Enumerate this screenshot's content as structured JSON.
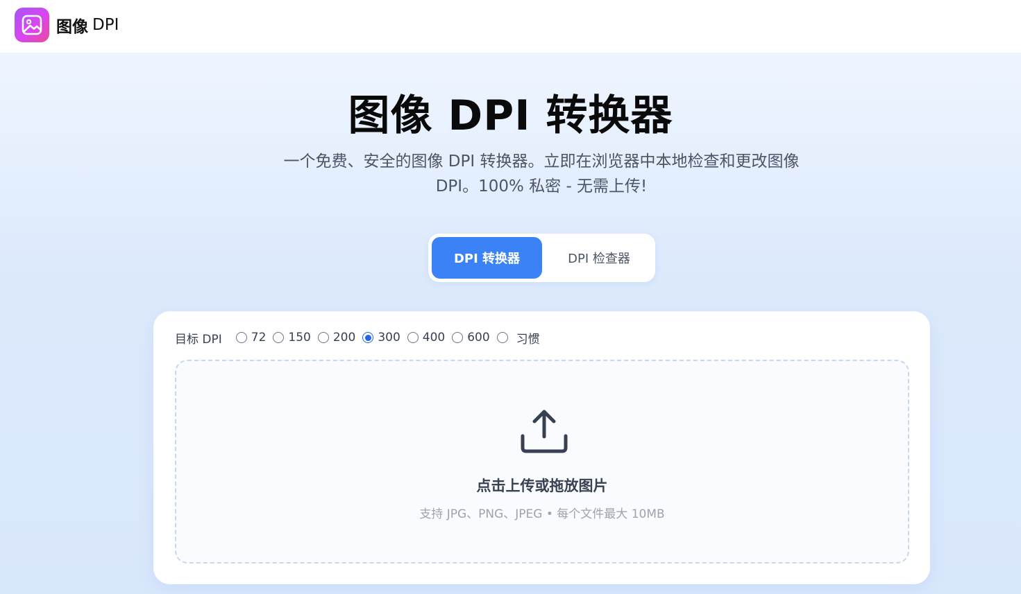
{
  "header": {
    "logo_icon": "image-icon",
    "brand_cn": "图像",
    "brand_en": "DPI"
  },
  "hero": {
    "title": "图像 DPI 转换器",
    "subtitle_line1": "一个免费、安全的图像 DPI 转换器。立即在浏览器中本地检查和更改图像",
    "subtitle_line2": "DPI。100% 私密 - 无需上传!"
  },
  "tabs": [
    {
      "label": "DPI 转换器",
      "active": true
    },
    {
      "label": "DPI 检查器",
      "active": false
    }
  ],
  "dpi_selector": {
    "label": "目标 DPI",
    "options": [
      "72",
      "150",
      "200",
      "300",
      "400",
      "600",
      "习惯"
    ],
    "selected": "300"
  },
  "dropzone": {
    "icon": "upload-icon",
    "title": "点击上传或拖放图片",
    "hint": "支持 JPG、PNG、JPEG • 每个文件最大 10MB"
  },
  "colors": {
    "accent": "#3b82f6",
    "logo_gradient_start": "#a855f7",
    "logo_gradient_end": "#ec4899"
  }
}
